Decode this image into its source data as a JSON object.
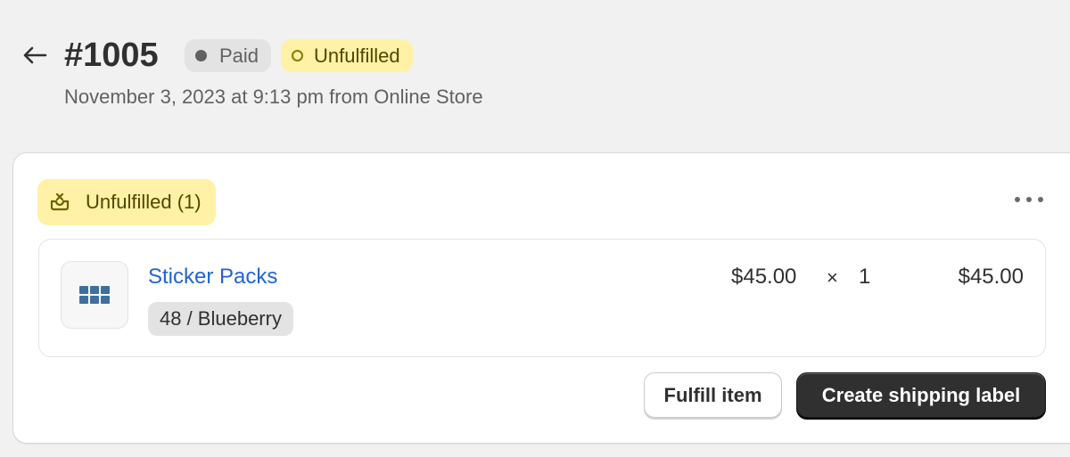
{
  "header": {
    "back_icon": "arrow-left-icon",
    "order_number": "#1005",
    "payment_badge": "Paid",
    "fulfillment_badge": "Unfulfilled",
    "subtitle": "November 3, 2023 at 9:13 pm from Online Store"
  },
  "fulfillment_card": {
    "status_icon": "unfulfilled-box-icon",
    "status_label": "Unfulfilled (1)",
    "more_icon": "more-horizontal-icon",
    "line_items": [
      {
        "image_icon": "sticker-sheet-icon",
        "product_name": "Sticker Packs",
        "variant": "48 / Blueberry",
        "unit_price": "$45.00",
        "times": "×",
        "quantity": "1",
        "total": "$45.00"
      }
    ],
    "actions": {
      "fulfill_label": "Fulfill item",
      "shipping_label": "Create shipping label"
    }
  },
  "colors": {
    "page_bg": "#f1f1f1",
    "card_bg": "#ffffff",
    "attention_bg": "#fff1a5",
    "attention_text": "#4f4700",
    "neutral_badge_bg": "#e3e3e3",
    "link": "#2463d1",
    "primary_button": "#303030"
  }
}
